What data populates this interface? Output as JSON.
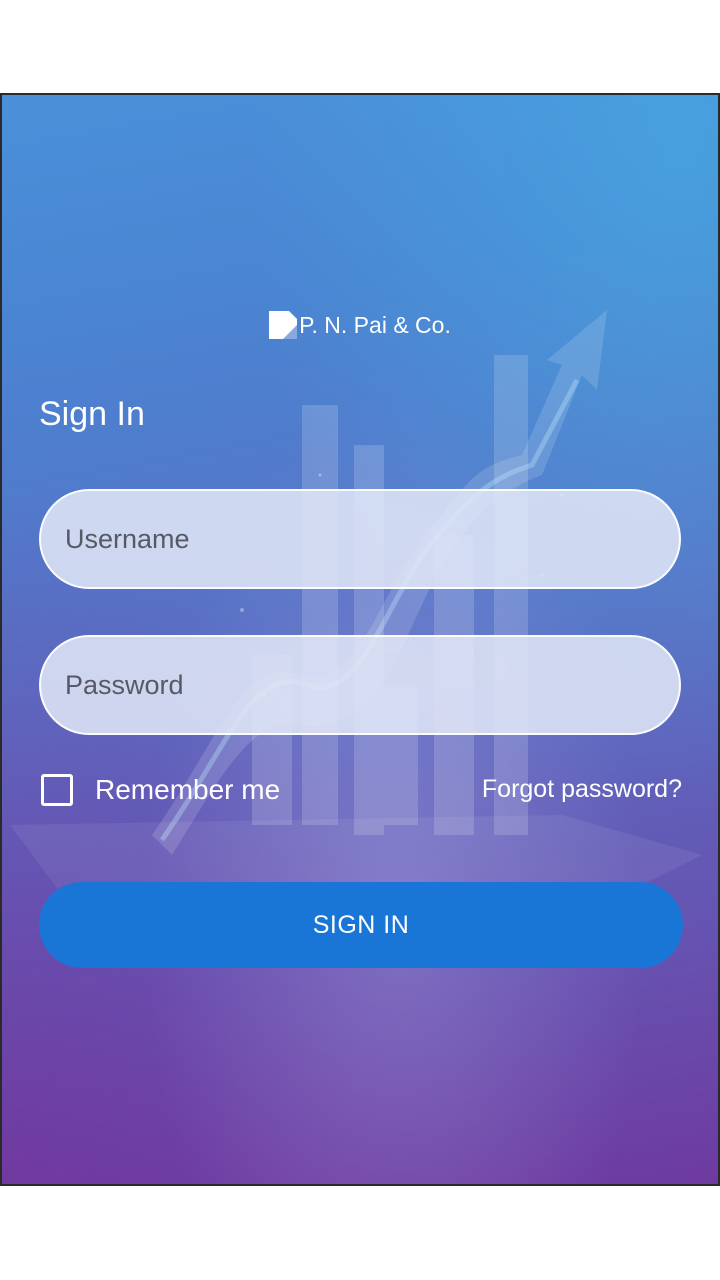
{
  "brand": {
    "logo_icon": "document-corner-icon",
    "name": "P. N. Pai & Co."
  },
  "form": {
    "title": "Sign In",
    "username_placeholder": "Username",
    "username_value": "",
    "password_placeholder": "Password",
    "password_value": "",
    "remember_label": "Remember me",
    "remember_checked": false,
    "forgot_label": "Forgot password?",
    "submit_label": "SIGN IN"
  },
  "colors": {
    "button": "#1a76d6",
    "background_top": "#4a90d9",
    "background_bottom": "#6e3aa0",
    "text": "#ffffff"
  }
}
